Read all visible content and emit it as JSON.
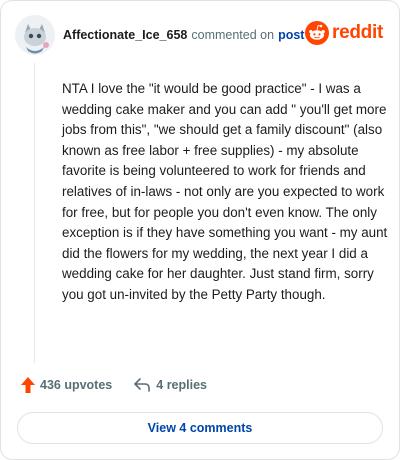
{
  "header": {
    "username": "Affectionate_Ice_658",
    "action_text": "commented on",
    "post_link": "post",
    "brand": "reddit"
  },
  "comment": {
    "text": "NTA I love the \"it would be good practice\" - I was a wedding cake maker and you can add \" you'll get more jobs from this\", \"we should get a family discount\" (also known as free labor + free supplies) - my absolute favorite is being volunteered to work for friends and relatives of in-laws - not only are you expected to work for free, but for people you don't even know. The only exception is if they have something you want - my aunt did the flowers for my wedding, the next year I did a wedding cake for her daughter. Just stand firm, sorry you got un-invited by the Petty Party though."
  },
  "actions": {
    "upvotes": "436 upvotes",
    "replies": "4 replies"
  },
  "footer": {
    "view_comments": "View 4 comments"
  },
  "colors": {
    "brand": "#ff4500",
    "link": "#0045ac",
    "muted": "#576f76",
    "upvote": "#ff4500"
  }
}
